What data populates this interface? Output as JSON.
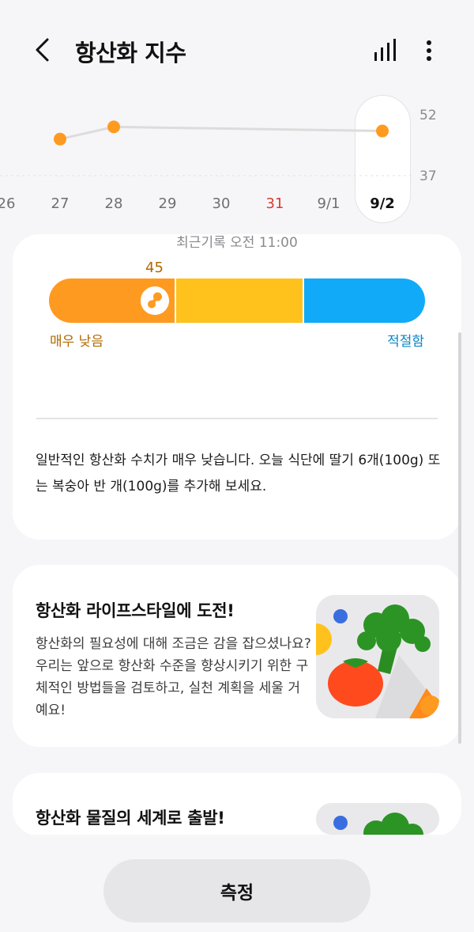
{
  "header": {
    "title": "항산화 지수"
  },
  "chart_data": {
    "type": "line",
    "x": [
      "26",
      "27",
      "28",
      "29",
      "30",
      "31",
      "9/1",
      "9/2"
    ],
    "y": [
      null,
      46,
      49,
      null,
      null,
      null,
      null,
      48
    ],
    "y_ticks": [
      "52",
      "37"
    ],
    "ylim": [
      37,
      52
    ],
    "selected_label": "9/2",
    "highlight_label": "31",
    "colors": {
      "point": "#ff9a20",
      "line": "#dcdcdc",
      "highlight": "#d93a30"
    }
  },
  "latest_record": "최근기록 오전 11:00",
  "index": {
    "score": "45",
    "level_low": "매우 낮음",
    "level_ok": "적절함",
    "description": "일반적인 항산화 수치가 매우 낮습니다. 오늘 식단에 딸기 6개(100g) 또는 복숭아 반 개(100g)를 추가해 보세요."
  },
  "cards": [
    {
      "title": "항산화 라이프스타일에 도전!",
      "body": "항산화의 필요성에 대해 조금은 감을 잡으셨나요? 우리는 앞으로 항산화 수준을 향상시키기 위한 구체적인 방법들을 검토하고, 실천 계획을 세울 거예요!"
    },
    {
      "title": "항산화 물질의 세계로 출발!"
    }
  ],
  "measure_button": "측정"
}
